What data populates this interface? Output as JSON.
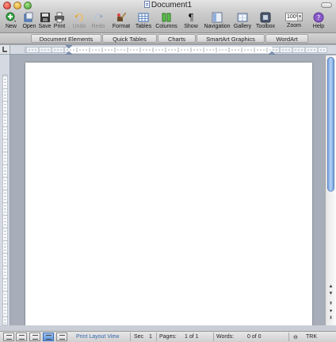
{
  "window": {
    "title": "Document1"
  },
  "toolbar": {
    "items": [
      {
        "label": "New"
      },
      {
        "label": "Open"
      },
      {
        "label": "Save"
      },
      {
        "label": "Print"
      },
      {
        "label": "Undo"
      },
      {
        "label": "Redo"
      },
      {
        "label": "Format"
      },
      {
        "label": "Tables"
      },
      {
        "label": "Columns"
      },
      {
        "label": "Show"
      },
      {
        "label": "Navigation"
      },
      {
        "label": "Gallery"
      },
      {
        "label": "Toolbox"
      },
      {
        "label": "Zoom"
      },
      {
        "label": "Help"
      }
    ],
    "zoom_value": "100%",
    "show_glyph": "¶"
  },
  "ribbon": {
    "tabs": [
      {
        "label": "Document Elements"
      },
      {
        "label": "Quick Tables"
      },
      {
        "label": "Charts"
      },
      {
        "label": "SmartArt Graphics"
      },
      {
        "label": "WordArt"
      }
    ]
  },
  "status": {
    "view_name": "Print Layout View",
    "sec_label": "Sec",
    "sec_value": "1",
    "pages_label": "Pages:",
    "pages_value": "1 of 1",
    "words_label": "Words:",
    "words_value": "0 of 0",
    "trk_label": "TRK"
  },
  "colors": {
    "accent": "#5b8fd6",
    "link": "#3565b0"
  }
}
